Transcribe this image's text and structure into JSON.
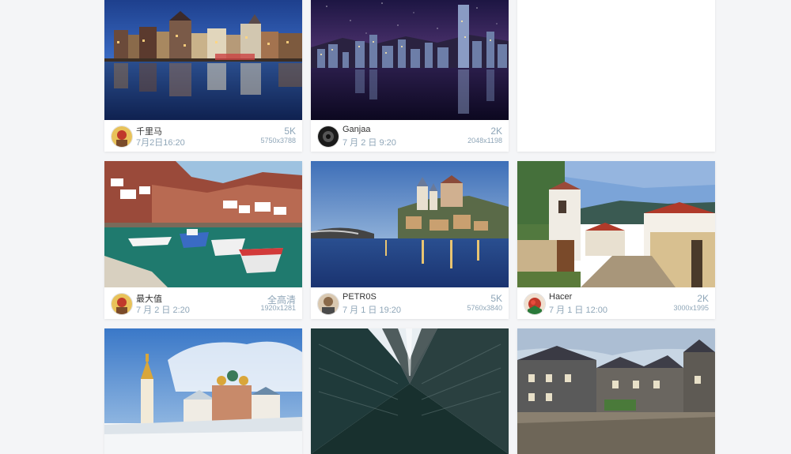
{
  "photos": [
    {
      "user": "千里马",
      "date": "7月2日16:20",
      "quality": "5K",
      "dims": "5750x3788"
    },
    {
      "user": "Ganjaa",
      "date": "7 月 2 日 9:20",
      "quality": "2K",
      "dims": "2048x1198"
    },
    {
      "user": "最大值",
      "date": "7 月 2 日 2:20",
      "quality": "全高清",
      "dims": "1920x1281"
    },
    {
      "user": "PETR0S",
      "date": "7 月 1 日 19:20",
      "quality": "5K",
      "dims": "5760x3840"
    },
    {
      "user": "Hacer",
      "date": "7 月 1 日 12:00",
      "quality": "2K",
      "dims": "3000x1995"
    }
  ],
  "colors": {
    "page_bg": "#f4f5f7",
    "meta_text": "#8fa6b8",
    "name_text": "#333333"
  }
}
